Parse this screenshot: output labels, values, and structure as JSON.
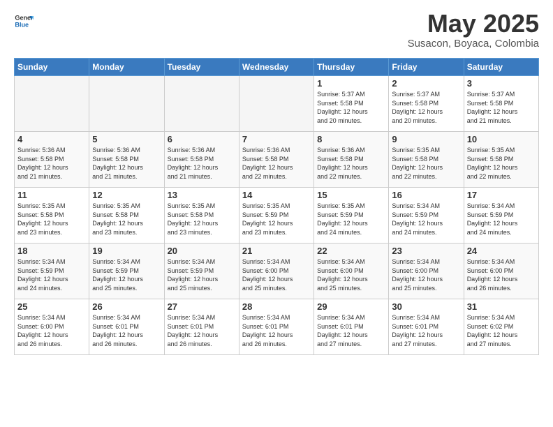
{
  "header": {
    "logo_line1": "General",
    "logo_line2": "Blue",
    "title": "May 2025",
    "subtitle": "Susacon, Boyaca, Colombia"
  },
  "weekdays": [
    "Sunday",
    "Monday",
    "Tuesday",
    "Wednesday",
    "Thursday",
    "Friday",
    "Saturday"
  ],
  "weeks": [
    [
      {
        "day": "",
        "info": ""
      },
      {
        "day": "",
        "info": ""
      },
      {
        "day": "",
        "info": ""
      },
      {
        "day": "",
        "info": ""
      },
      {
        "day": "1",
        "info": "Sunrise: 5:37 AM\nSunset: 5:58 PM\nDaylight: 12 hours\nand 20 minutes."
      },
      {
        "day": "2",
        "info": "Sunrise: 5:37 AM\nSunset: 5:58 PM\nDaylight: 12 hours\nand 20 minutes."
      },
      {
        "day": "3",
        "info": "Sunrise: 5:37 AM\nSunset: 5:58 PM\nDaylight: 12 hours\nand 21 minutes."
      }
    ],
    [
      {
        "day": "4",
        "info": "Sunrise: 5:36 AM\nSunset: 5:58 PM\nDaylight: 12 hours\nand 21 minutes."
      },
      {
        "day": "5",
        "info": "Sunrise: 5:36 AM\nSunset: 5:58 PM\nDaylight: 12 hours\nand 21 minutes."
      },
      {
        "day": "6",
        "info": "Sunrise: 5:36 AM\nSunset: 5:58 PM\nDaylight: 12 hours\nand 21 minutes."
      },
      {
        "day": "7",
        "info": "Sunrise: 5:36 AM\nSunset: 5:58 PM\nDaylight: 12 hours\nand 22 minutes."
      },
      {
        "day": "8",
        "info": "Sunrise: 5:36 AM\nSunset: 5:58 PM\nDaylight: 12 hours\nand 22 minutes."
      },
      {
        "day": "9",
        "info": "Sunrise: 5:35 AM\nSunset: 5:58 PM\nDaylight: 12 hours\nand 22 minutes."
      },
      {
        "day": "10",
        "info": "Sunrise: 5:35 AM\nSunset: 5:58 PM\nDaylight: 12 hours\nand 22 minutes."
      }
    ],
    [
      {
        "day": "11",
        "info": "Sunrise: 5:35 AM\nSunset: 5:58 PM\nDaylight: 12 hours\nand 23 minutes."
      },
      {
        "day": "12",
        "info": "Sunrise: 5:35 AM\nSunset: 5:58 PM\nDaylight: 12 hours\nand 23 minutes."
      },
      {
        "day": "13",
        "info": "Sunrise: 5:35 AM\nSunset: 5:58 PM\nDaylight: 12 hours\nand 23 minutes."
      },
      {
        "day": "14",
        "info": "Sunrise: 5:35 AM\nSunset: 5:59 PM\nDaylight: 12 hours\nand 23 minutes."
      },
      {
        "day": "15",
        "info": "Sunrise: 5:35 AM\nSunset: 5:59 PM\nDaylight: 12 hours\nand 24 minutes."
      },
      {
        "day": "16",
        "info": "Sunrise: 5:34 AM\nSunset: 5:59 PM\nDaylight: 12 hours\nand 24 minutes."
      },
      {
        "day": "17",
        "info": "Sunrise: 5:34 AM\nSunset: 5:59 PM\nDaylight: 12 hours\nand 24 minutes."
      }
    ],
    [
      {
        "day": "18",
        "info": "Sunrise: 5:34 AM\nSunset: 5:59 PM\nDaylight: 12 hours\nand 24 minutes."
      },
      {
        "day": "19",
        "info": "Sunrise: 5:34 AM\nSunset: 5:59 PM\nDaylight: 12 hours\nand 25 minutes."
      },
      {
        "day": "20",
        "info": "Sunrise: 5:34 AM\nSunset: 5:59 PM\nDaylight: 12 hours\nand 25 minutes."
      },
      {
        "day": "21",
        "info": "Sunrise: 5:34 AM\nSunset: 6:00 PM\nDaylight: 12 hours\nand 25 minutes."
      },
      {
        "day": "22",
        "info": "Sunrise: 5:34 AM\nSunset: 6:00 PM\nDaylight: 12 hours\nand 25 minutes."
      },
      {
        "day": "23",
        "info": "Sunrise: 5:34 AM\nSunset: 6:00 PM\nDaylight: 12 hours\nand 25 minutes."
      },
      {
        "day": "24",
        "info": "Sunrise: 5:34 AM\nSunset: 6:00 PM\nDaylight: 12 hours\nand 26 minutes."
      }
    ],
    [
      {
        "day": "25",
        "info": "Sunrise: 5:34 AM\nSunset: 6:00 PM\nDaylight: 12 hours\nand 26 minutes."
      },
      {
        "day": "26",
        "info": "Sunrise: 5:34 AM\nSunset: 6:01 PM\nDaylight: 12 hours\nand 26 minutes."
      },
      {
        "day": "27",
        "info": "Sunrise: 5:34 AM\nSunset: 6:01 PM\nDaylight: 12 hours\nand 26 minutes."
      },
      {
        "day": "28",
        "info": "Sunrise: 5:34 AM\nSunset: 6:01 PM\nDaylight: 12 hours\nand 26 minutes."
      },
      {
        "day": "29",
        "info": "Sunrise: 5:34 AM\nSunset: 6:01 PM\nDaylight: 12 hours\nand 27 minutes."
      },
      {
        "day": "30",
        "info": "Sunrise: 5:34 AM\nSunset: 6:01 PM\nDaylight: 12 hours\nand 27 minutes."
      },
      {
        "day": "31",
        "info": "Sunrise: 5:34 AM\nSunset: 6:02 PM\nDaylight: 12 hours\nand 27 minutes."
      }
    ]
  ]
}
